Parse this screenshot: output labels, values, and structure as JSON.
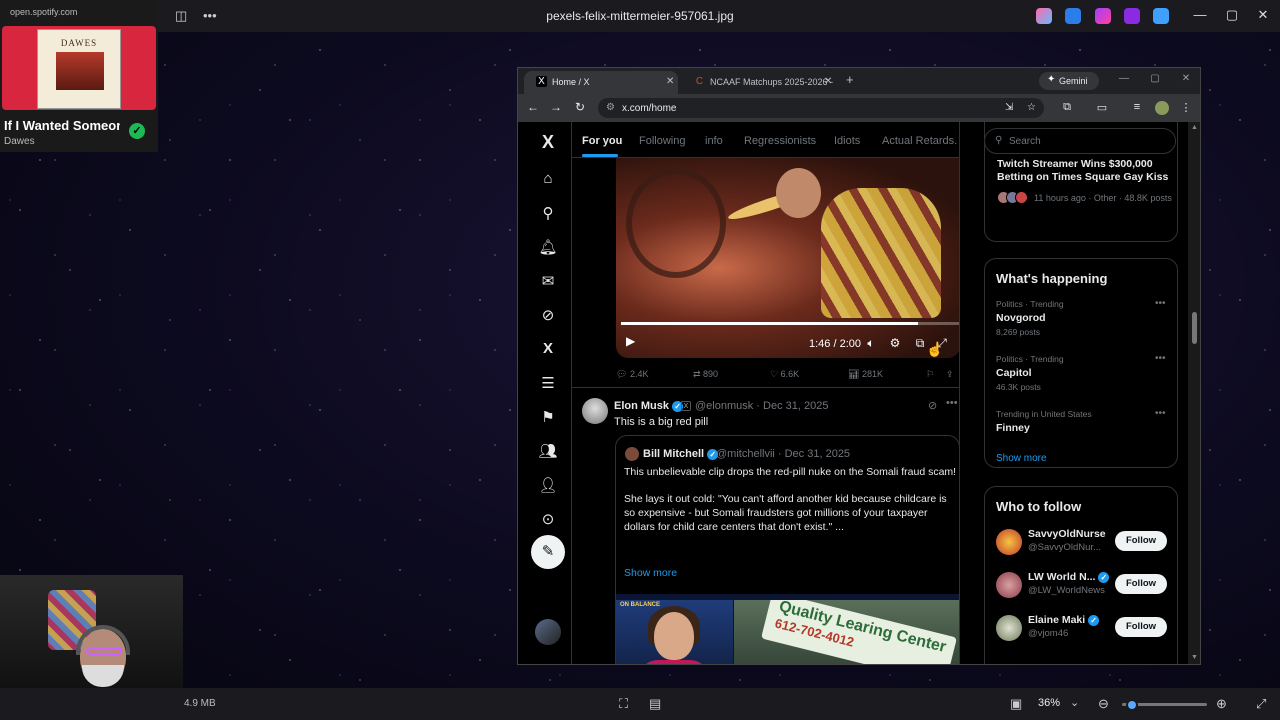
{
  "viewer": {
    "title": "pexels-felix-mittermeier-957061.jpg",
    "file_size": "4.9 MB",
    "zoom": "36%",
    "zoom_level_fraction": 0.05
  },
  "spotify": {
    "url": "open.spotify.com",
    "cover_title": "DAWES",
    "song": "If I Wanted Someone",
    "artist": "Dawes",
    "check": "✓"
  },
  "browser": {
    "tabs": [
      {
        "title": "Home / X",
        "fav": "X"
      },
      {
        "title": "NCAAF Matchups 2025-2026 -",
        "fav": "C"
      }
    ],
    "newtab": "+",
    "gemini": "Gemini",
    "url": "x.com/home"
  },
  "x": {
    "logo": "X",
    "feed_tabs": [
      "For you",
      "Following",
      "info",
      "Regressionists",
      "Idiots",
      "Actual Retards."
    ],
    "video": {
      "time": "1:46 / 2:00",
      "progress": 0.88
    },
    "actions": {
      "replies": "2.4K",
      "reposts": "890",
      "likes": "6.6K",
      "views": "281K"
    },
    "tweet": {
      "name": "Elon Musk",
      "meta": "@elonmusk · Dec 31, 2025",
      "text": "This is a big red pill",
      "quote": {
        "name": "Bill Mitchell",
        "meta": "@mitchellvii · Dec 31, 2025",
        "line1": "This unbelievable clip drops the red-pill nuke on the Somali fraud scam!",
        "line2": "She lays it out cold: \"You can't afford another kid because childcare is",
        "line3": "so expensive - but Somali fraudsters got millions of your taxpayer",
        "line4": "dollars for child care centers that don't exist.\" ...",
        "show_more": "Show more",
        "banner": "ON BALANCE",
        "sign": "Quality Learing Center",
        "sign_number": "612-702-4012"
      }
    },
    "sidebar": {
      "search_placeholder": "Search",
      "top_trend": {
        "headline": "Twitch Streamer Wins $300,000 Betting on Times Square Gay Kiss",
        "sub": "11 hours ago · Other · 48.8K posts"
      },
      "happening": {
        "heading": "What's happening",
        "trends": [
          {
            "meta": "Politics · Trending",
            "name": "Novgorod",
            "count": "8,269 posts"
          },
          {
            "meta": "Politics · Trending",
            "name": "Capitol",
            "count": "46.3K posts"
          },
          {
            "meta": "Trending in United States",
            "name": "Finney",
            "count": ""
          }
        ],
        "show_more": "Show more"
      },
      "who_to_follow": {
        "heading": "Who to follow",
        "people": [
          {
            "name": "SavvyOldNurse",
            "handle": "@SavvyOldNur...",
            "button": "Follow"
          },
          {
            "name": "LW World N...",
            "handle": "@LW_WorldNews",
            "button": "Follow"
          },
          {
            "name": "Elaine Maki",
            "handle": "@vjom46",
            "button": "Follow"
          }
        ]
      }
    }
  },
  "colors": {
    "accent": "#1d9bf0",
    "spotify_green": "#1db954",
    "spotify_red": "#d7263d"
  }
}
